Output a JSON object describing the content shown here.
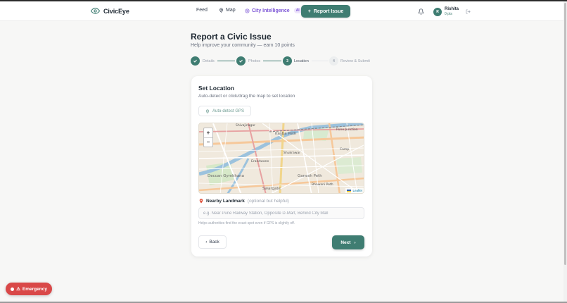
{
  "app": {
    "name": "CivicEye"
  },
  "nav": {
    "feed": "Feed",
    "map": "Map",
    "city_intelligence": "City Intelligence",
    "ai_badge": "AI",
    "report_issue": "Report Issue"
  },
  "user": {
    "initial": "R",
    "name": "Rishita",
    "points": "0 pts"
  },
  "page": {
    "title": "Report a Civic Issue",
    "subtitle": "Help improve your community — earn 10 points"
  },
  "steps": [
    {
      "number": "1",
      "label": "Details",
      "status": "done"
    },
    {
      "number": "2",
      "label": "Photos",
      "status": "done"
    },
    {
      "number": "3",
      "label": "Location",
      "status": "active"
    },
    {
      "number": "4",
      "label": "Review & Submit",
      "status": "todo"
    }
  ],
  "location": {
    "title": "Set Location",
    "subtitle": "Auto-detect or click/drag the map to set location",
    "gps_button": "Auto-detect GPS"
  },
  "map": {
    "zoom_in": "+",
    "zoom_out": "−",
    "attribution": "Leaflet",
    "labels": [
      "Shivajinagar",
      "Pune Junction",
      "Kasba Peth",
      "Deccan Gymkhana",
      "Swargate",
      "Ganesh Peth",
      "Camp",
      "Erandwane",
      "Bhawani Peth",
      "Shukrawar"
    ]
  },
  "landmark": {
    "label": "Nearby Landmark",
    "optional": "(optional but helpful)",
    "placeholder": "e.g. Near Pune Railway Station, Opposite D-Mart, Behind City Mall",
    "help": "Helps authorities find the exact spot even if GPS is slightly off."
  },
  "actions": {
    "back": "Back",
    "next": "Next"
  },
  "emergency": {
    "label": "Emergency"
  },
  "colors": {
    "accent": "#3f7d72",
    "ai": "#7c55d6",
    "emergency": "#d94848"
  }
}
